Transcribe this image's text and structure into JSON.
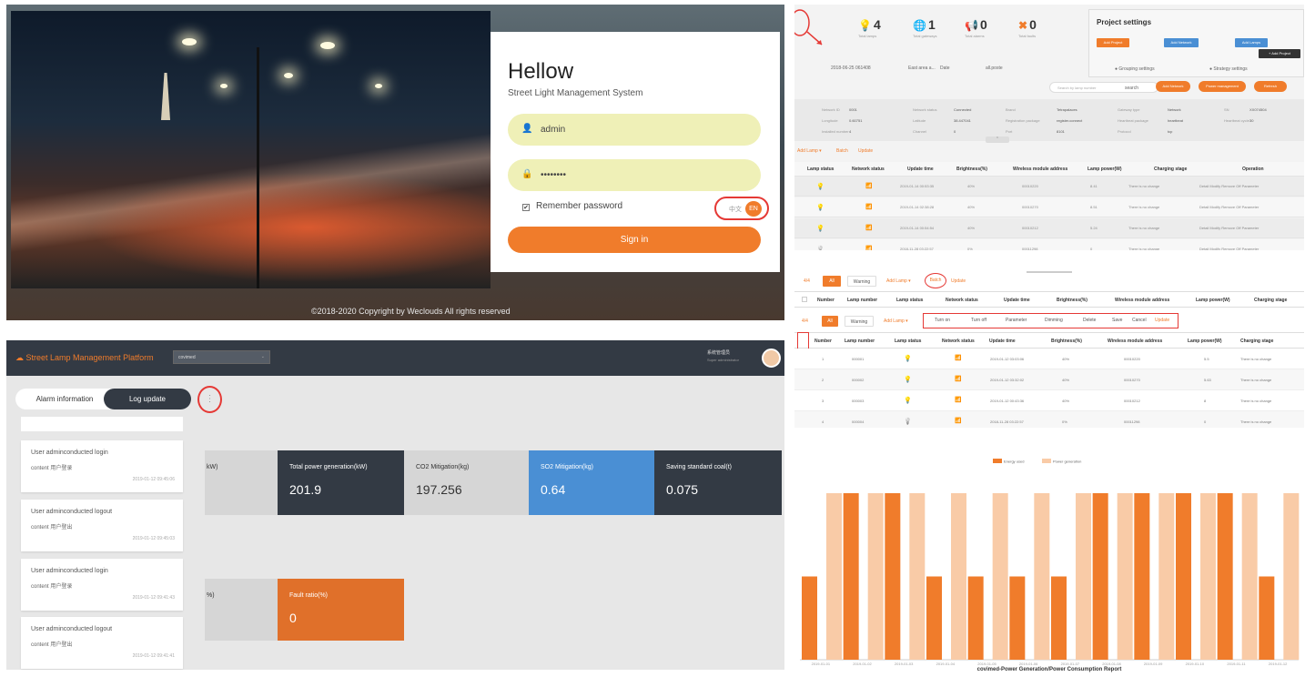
{
  "login": {
    "title": "Hellow",
    "subtitle": "Street Light Management System",
    "username": "admin",
    "password": "••••••••",
    "remember": "Remember password",
    "lang_cn": "中文",
    "lang_en": "EN",
    "signin": "Sign in",
    "copyright": "©2018-2020 Copyright by Weclouds All rights reserved",
    "icons": {
      "user": "user-icon",
      "lock": "lock-icon"
    }
  },
  "project": {
    "stats": [
      {
        "value": "4",
        "label": "Total lamps",
        "icon": "lamp-icon"
      },
      {
        "value": "1",
        "label": "Total gateways",
        "icon": "globe-icon"
      },
      {
        "value": "0",
        "label": "Total alarms",
        "icon": "alarm-icon"
      },
      {
        "value": "0",
        "label": "Total faults",
        "icon": "wrench-icon"
      }
    ],
    "settings_title": "Project settings",
    "settings_buttons": [
      "Add Project",
      "Add Network",
      "Add Lamps"
    ],
    "grouping": "Grouping settings",
    "strategy": "Strategy settings",
    "add_project": "+ Add Project",
    "info_row": [
      "2018-06-25 061408",
      "East area a...",
      "Date",
      "all.poste"
    ],
    "search_placeholder": "Search by lamp number",
    "search_btn": "search",
    "action_btns": [
      "Add Network",
      "Power management",
      "Refresh"
    ],
    "details": [
      [
        "Network ID",
        "0001",
        "Network status",
        "Connected",
        "Brand",
        "Tetrapalaces",
        "Gateway type",
        "Network",
        "SN",
        "XX074504"
      ],
      [
        "Longitude",
        "0.60751",
        "Latitude",
        "38.447041",
        "Registration package",
        "register.connect",
        "Heartbeat package",
        "heartbeat",
        "Heartbeat cycle",
        "30"
      ],
      [
        "Installed number",
        "4",
        "Channel",
        "0",
        "Port",
        "8101",
        "Protocol",
        "tcp"
      ]
    ],
    "toolbar": [
      "Add Lamp ▾",
      "Batch",
      "Update"
    ],
    "columns": [
      "Lamp status",
      "Network status",
      "Update time",
      "Brightness(%)",
      "Wireless module address",
      "Lamp power(W)",
      "Charging stage",
      "Operation"
    ],
    "rows": [
      [
        "2019-01-14 00:53:35",
        "40%",
        "00010220",
        "8.41",
        "There is no change",
        "Detail  Modify  Remove  Off  Parameter"
      ],
      [
        "2019-01-14 02:38:28",
        "40%",
        "00010270",
        "8.51",
        "There is no change",
        "Detail  Modify  Remove  Off  Parameter"
      ],
      [
        "2019-01-14 00:54:54",
        "40%",
        "00010212",
        "5.24",
        "There is no change",
        "Detail  Modify  Remove  Off  Parameter"
      ],
      [
        "2018-11-28 03:22:57",
        "0%",
        "00011298",
        "0",
        "There is no change",
        "Detail  Modify  Remove  Off  Parameter"
      ]
    ]
  },
  "batch": {
    "count": "4/4",
    "tab_all": "All",
    "tab_warning": "Warning",
    "add_lamp": "Add Lamp ▾",
    "batch": "Batch",
    "update": "Update",
    "top_columns": [
      "Number",
      "Lamp number",
      "Lamp status",
      "Network status",
      "Update time",
      "Brightness(%)",
      "Wireless module address",
      "Lamp power(W)",
      "Charging stage"
    ],
    "batch_actions": [
      "Turn on",
      "Turn off",
      "Parameter",
      "Dimming",
      "Delete",
      "Save",
      "Cancel",
      "Update"
    ],
    "columns": [
      "Number",
      "Lamp number",
      "Lamp status",
      "Network status",
      "Update time",
      "Brightness(%)",
      "Wireless module address",
      "Lamp power(W)",
      "Charging stage"
    ],
    "rows": [
      [
        "1",
        "000001",
        "2019-01-12 03:03:06",
        "40%",
        "00010220",
        "5.5",
        "There is no change"
      ],
      [
        "2",
        "000002",
        "2019-01-12 03:32:02",
        "40%",
        "00010270",
        "5.63",
        "There is no change"
      ],
      [
        "3",
        "000003",
        "2019-01-12 00:43:36",
        "40%",
        "00010212",
        "8",
        "There is no change"
      ],
      [
        "4",
        "000004",
        "2018-11-28 03:22:57",
        "0%",
        "00011298",
        "0",
        "There is no change"
      ]
    ]
  },
  "dashboard": {
    "logo": "Street Lamp Management Platform",
    "project_select": "covimed",
    "user_name": "系统管理员",
    "user_role": "Super administrator",
    "tab_alarm": "Alarm information",
    "tab_log": "Log update",
    "more": "⋮",
    "logs": [
      {
        "actor": "User adminconducted login",
        "content": "content 用户登录",
        "time": "2019-01-12 09:45:06"
      },
      {
        "actor": "User adminconducted logout",
        "content": "content 用户登出",
        "time": "2019-01-12 09:45:03"
      },
      {
        "actor": "User adminconducted login",
        "content": "content 用户登录",
        "time": "2019-01-12 09:41:43"
      },
      {
        "actor": "User adminconducted logout",
        "content": "content 用户登出",
        "time": "2019-01-12 09:41:41"
      }
    ],
    "metrics": [
      {
        "label": "kW)",
        "value": "",
        "bg": "#d6d6d6",
        "fg": "#333"
      },
      {
        "label": "Total power generation(kW)",
        "value": "201.9",
        "bg": "#333a44",
        "fg": "#fff"
      },
      {
        "label": "CO2 Mitigation(kg)",
        "value": "197.256",
        "bg": "#d6d6d6",
        "fg": "#333"
      },
      {
        "label": "SO2 Mitigation(kg)",
        "value": "0.64",
        "bg": "#4a8fd4",
        "fg": "#fff"
      },
      {
        "label": "Saving standard coal(t)",
        "value": "0.075",
        "bg": "#333a44",
        "fg": "#fff"
      }
    ],
    "metrics2": [
      {
        "label": "%)",
        "value": "",
        "bg": "#d6d6d6",
        "fg": "#333"
      },
      {
        "label": "Fault ratio(%)",
        "value": "0",
        "bg": "#e0702a",
        "fg": "#fff"
      }
    ]
  },
  "chart_data": {
    "type": "bar",
    "title": "covimed-Power Generation/Power Consumption Report",
    "categories": [
      "2019-01-01",
      "2019-01-02",
      "2019-01-03",
      "2019-01-04",
      "2019-01-05",
      "2019-01-06",
      "2019-01-07",
      "2019-01-08",
      "2019-01-09",
      "2019-01-10",
      "2019-01-11",
      "2019-01-12"
    ],
    "series": [
      {
        "name": "Energy used",
        "color": "#f07c2b",
        "values": [
          50,
          100,
          100,
          50,
          50,
          50,
          50,
          100,
          100,
          100,
          100,
          50
        ]
      },
      {
        "name": "Power generation",
        "color": "#f9cba7",
        "values": [
          100,
          100,
          100,
          100,
          100,
          100,
          100,
          100,
          100,
          100,
          100,
          100
        ]
      }
    ],
    "ylim": [
      0,
      100
    ],
    "legend": "top-center"
  }
}
